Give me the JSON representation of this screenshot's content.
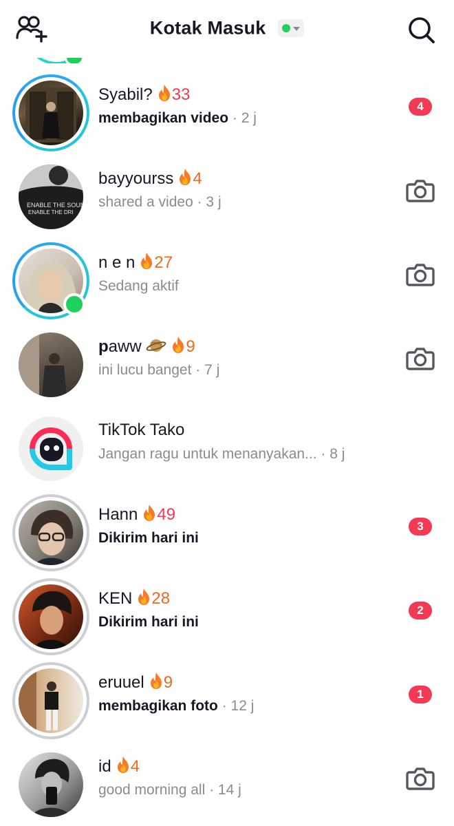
{
  "header": {
    "title": "Kotak Masuk",
    "status_color": "#1dd15c",
    "add_friends_icon": "add-friends-icon",
    "search_icon": "search-icon"
  },
  "colors": {
    "streak_orange": "#ee6a1e",
    "streak_red": "#f23a55",
    "badge_red": "#f23a55",
    "online_green": "#1dd15c",
    "ring_blue": "#21c6d9",
    "muted": "#8a8b91"
  },
  "chats": [
    {
      "name": "Syabil?",
      "streak": "33",
      "streak_color": "red",
      "subtitle": "membagikan video",
      "time": "· 2 j",
      "badge": "4",
      "ring": "blue"
    },
    {
      "name": "bayyourss",
      "streak": "4",
      "streak_color": "orange",
      "subtitle": "shared a video",
      "time": "· 3 j",
      "action": "camera-icon",
      "ring": "none"
    },
    {
      "name": "n e n",
      "streak": "27",
      "streak_color": "orange",
      "subtitle": "Sedang aktif",
      "time": "",
      "action": "camera-icon",
      "ring": "blue",
      "online": true
    },
    {
      "name_bold_part": "p",
      "name": "aww",
      "emoji": "ringed-planet",
      "streak": "9",
      "streak_color": "orange",
      "subtitle": "ini lucu banget",
      "time": "· 7 j",
      "action": "camera-icon",
      "ring": "none"
    },
    {
      "name": "TikTok Tako",
      "subtitle": "Jangan ragu untuk menanyakan...",
      "time": "· 8 j",
      "ring": "none"
    },
    {
      "name": "Hann",
      "streak": "49",
      "streak_color": "red",
      "subtitle": "Dikirim hari ini",
      "time": "",
      "badge": "3",
      "ring": "grey"
    },
    {
      "name": "KEN",
      "streak": "28",
      "streak_color": "orange",
      "subtitle": "Dikirim hari ini",
      "time": "",
      "badge": "2",
      "ring": "grey"
    },
    {
      "name": "eruuel",
      "streak": "9",
      "streak_color": "orange",
      "subtitle": "membagikan foto",
      "time": "· 12 j",
      "badge": "1",
      "ring": "grey"
    },
    {
      "name": "id",
      "streak": "4",
      "streak_color": "orange",
      "subtitle": "good morning all",
      "time": "· 14 j",
      "action": "camera-icon",
      "ring": "none"
    }
  ]
}
